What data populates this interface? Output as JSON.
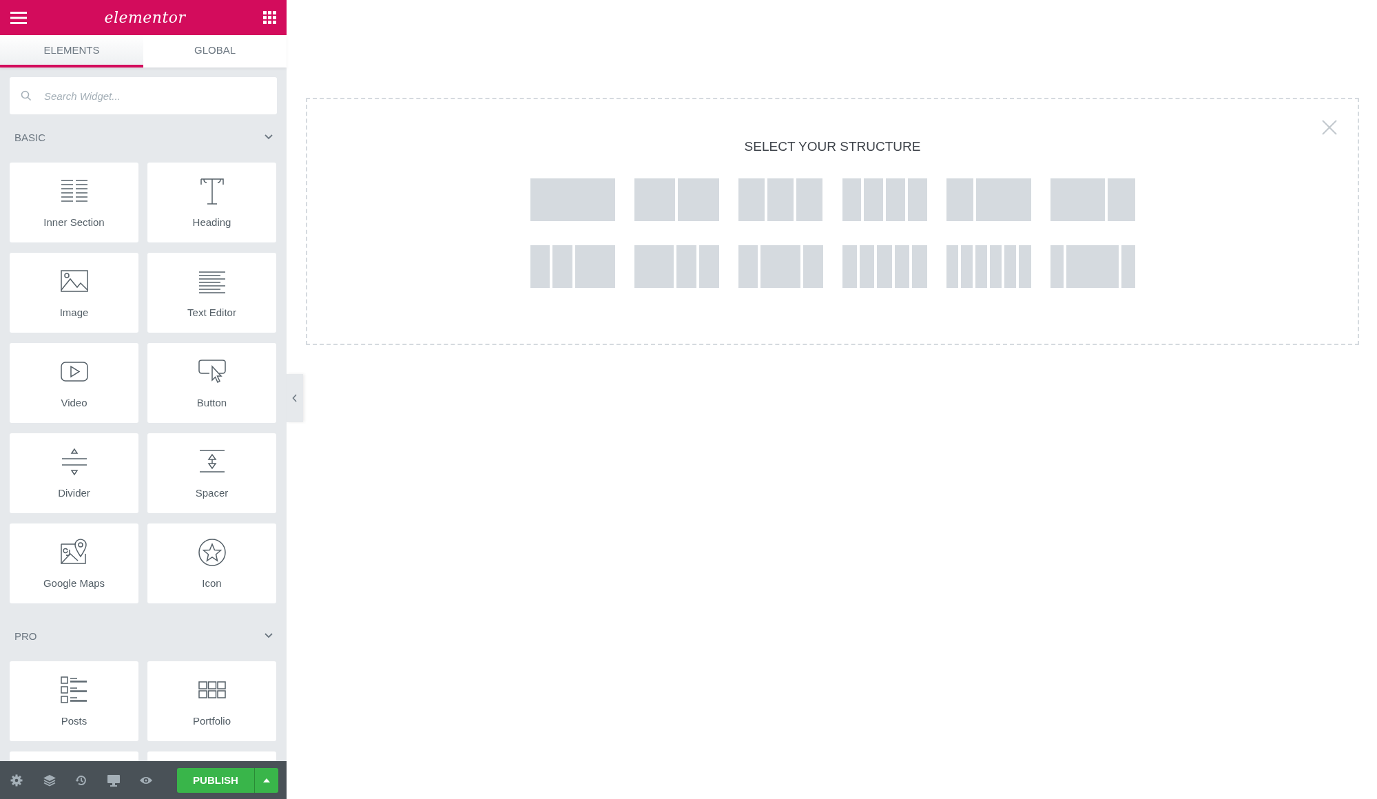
{
  "header": {
    "logo": "elementor"
  },
  "tabs": [
    {
      "label": "ELEMENTS",
      "selected": true
    },
    {
      "label": "GLOBAL",
      "selected": false
    }
  ],
  "search": {
    "placeholder": "Search Widget..."
  },
  "categories": [
    {
      "title": "BASIC",
      "expanded": true,
      "widgets": [
        {
          "label": "Inner Section"
        },
        {
          "label": "Heading"
        },
        {
          "label": "Image"
        },
        {
          "label": "Text Editor"
        },
        {
          "label": "Video"
        },
        {
          "label": "Button"
        },
        {
          "label": "Divider"
        },
        {
          "label": "Spacer"
        },
        {
          "label": "Google Maps"
        },
        {
          "label": "Icon"
        }
      ]
    },
    {
      "title": "PRO",
      "expanded": true,
      "widgets": [
        {
          "label": "Posts"
        },
        {
          "label": "Portfolio"
        }
      ]
    }
  ],
  "footer": {
    "publish": "PUBLISH"
  },
  "canvas": {
    "title": "SELECT YOUR STRUCTURE"
  }
}
